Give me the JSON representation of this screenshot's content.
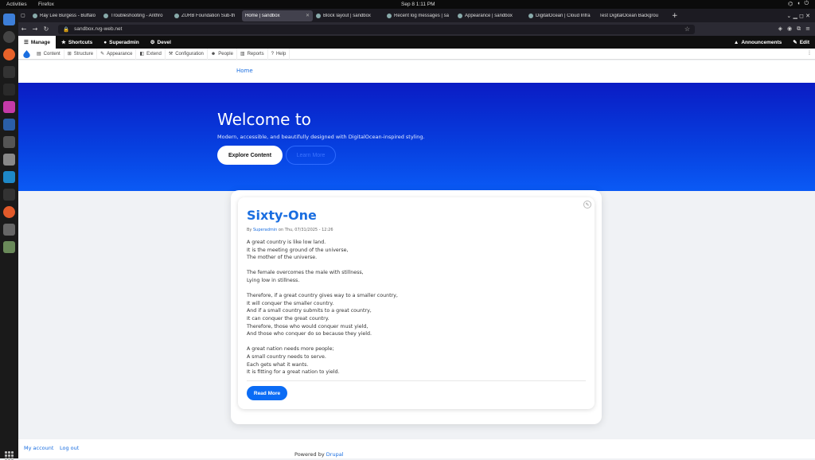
{
  "system_bar": {
    "activities": "Activities",
    "app": "Firefox",
    "clock": "Sep 8   1:11 PM"
  },
  "browser": {
    "tabs": [
      {
        "title": "Ray Lee Burgess - Buffalo"
      },
      {
        "title": "Troubleshooting - Anthro"
      },
      {
        "title": "ZURB Foundation Sub-th"
      },
      {
        "title": "Home | sandbox",
        "active": true
      },
      {
        "title": "Block layout | sandbox"
      },
      {
        "title": "Recent log messages | sa"
      },
      {
        "title": "Appearance | sandbox"
      },
      {
        "title": "DigitalOcean | Cloud Infra"
      },
      {
        "title": "Test DigitalOcean Backgrou"
      }
    ],
    "new_tab": "+",
    "url": "sandbox.rvg-web.net"
  },
  "toolbar": {
    "manage": "Manage",
    "shortcuts": "Shortcuts",
    "user": "Superadmin",
    "devel": "Devel",
    "announcements": "Announcements",
    "edit": "Edit"
  },
  "admin_tray": {
    "items": [
      "Content",
      "Structure",
      "Appearance",
      "Extend",
      "Configuration",
      "People",
      "Reports",
      "Help"
    ]
  },
  "breadcrumb": {
    "home": "Home"
  },
  "hero": {
    "title": "Welcome to",
    "subtitle": "Modern, accessible, and beautifully designed with DigitalOcean-inspired styling.",
    "primary_button": "Explore Content",
    "secondary_button": "Learn More"
  },
  "article": {
    "title": "Sixty-One",
    "byline_prefix": "By",
    "author": "Superadmin",
    "byline_suffix": "on Thu, 07/31/2025 - 12:26",
    "stanzas": [
      [
        "A great country is like low land.",
        "It is the meeting ground of the universe,",
        "The mother of the universe."
      ],
      [
        "The female overcomes the male with stillness,",
        "Lying low in stillness."
      ],
      [
        "Therefore, if a great country gives way to a smaller country,",
        "It will conquer the smaller country.",
        "And if a small country submits to a great country,",
        "It can conquer the great country.",
        "Therefore, those who would conquer must yield,",
        "And those who conquer do so because they yield."
      ],
      [
        "A great nation needs more people;",
        "A small country needs to serve.",
        "Each gets what it wants.",
        "It is fitting for a great nation to yield."
      ]
    ],
    "read_more": "Read More"
  },
  "footer": {
    "my_account": "My account",
    "log_out": "Log out",
    "powered_by": "Powered by",
    "drupal": "Drupal"
  },
  "colors": {
    "accent": "#1a6ee0",
    "hero_top": "#0a1cc4",
    "hero_bottom": "#0a5af5",
    "button_blue": "#0b6cf5"
  }
}
